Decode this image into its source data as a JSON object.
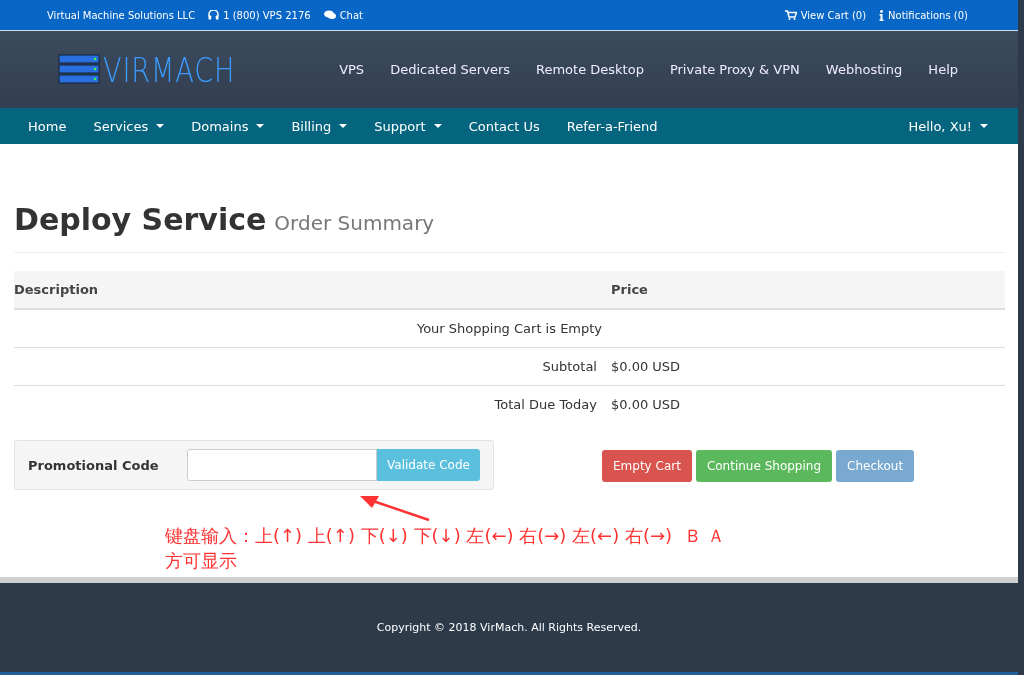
{
  "topbar": {
    "company": "Virtual Machine Solutions LLC",
    "phone": "1 (800) VPS 2176",
    "chat": "Chat",
    "cart": "View Cart (0)",
    "notifications": "Notifications (0)"
  },
  "header": {
    "logo": "VIRMACH",
    "links": [
      "VPS",
      "Dedicated Servers",
      "Remote Desktop",
      "Private Proxy & VPN",
      "Webhosting",
      "Help"
    ]
  },
  "navbar": {
    "items": [
      {
        "label": "Home",
        "dropdown": false
      },
      {
        "label": "Services",
        "dropdown": true
      },
      {
        "label": "Domains",
        "dropdown": true
      },
      {
        "label": "Billing",
        "dropdown": true
      },
      {
        "label": "Support",
        "dropdown": true
      },
      {
        "label": "Contact Us",
        "dropdown": false
      },
      {
        "label": "Refer-a-Friend",
        "dropdown": false
      }
    ],
    "user": {
      "label": "Hello, Xu!",
      "dropdown": true
    }
  },
  "page": {
    "title": "Deploy Service",
    "subtitle": "Order Summary"
  },
  "table": {
    "columns": [
      "Description",
      "Price"
    ],
    "empty": "Your Shopping Cart is Empty",
    "totals": [
      {
        "label": "Subtotal",
        "value": "$0.00 USD"
      },
      {
        "label": "Total Due Today",
        "value": "$0.00 USD"
      }
    ]
  },
  "promo": {
    "label": "Promotional Code",
    "button": "Validate Code"
  },
  "buttons": [
    {
      "label": "Empty Cart",
      "kind": "danger",
      "disabled": false
    },
    {
      "label": "Continue Shopping",
      "kind": "success",
      "disabled": false
    },
    {
      "label": "Checkout",
      "kind": "primary",
      "disabled": true
    }
  ],
  "annotation": {
    "lines": [
      "键盘输入：上(↑) 上(↑) 下(↓) 下(↓) 左(←) 右(→) 左(←) 右(→)  Ｂ Ａ",
      "方可显示"
    ]
  },
  "footer": {
    "copyright": "Copyright © 2018 VirMach. All Rights Reserved."
  }
}
